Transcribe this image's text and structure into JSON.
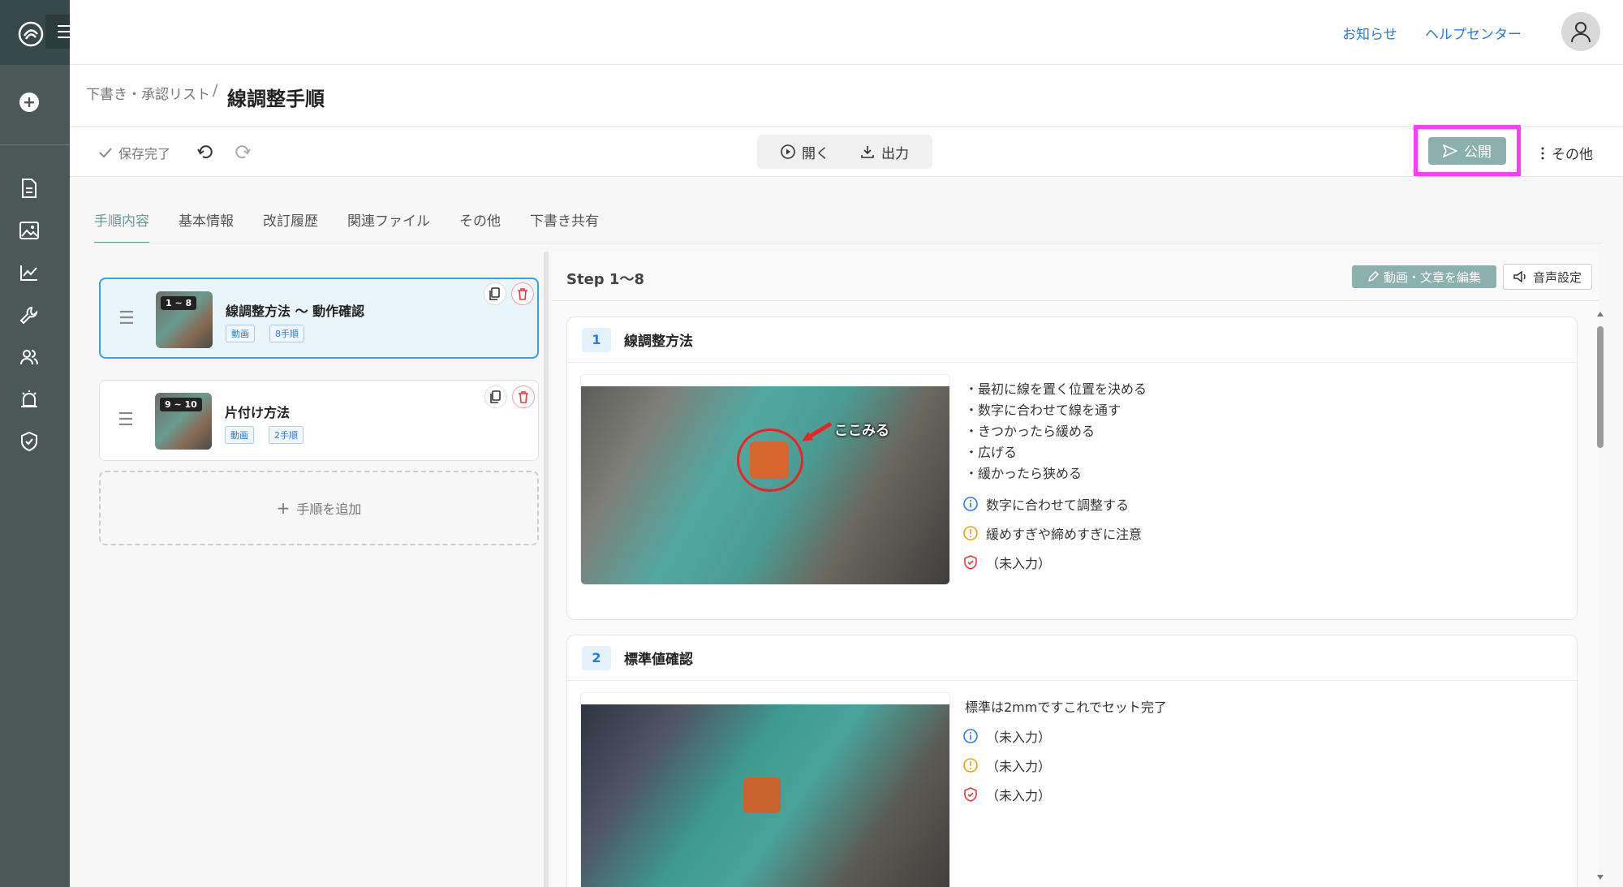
{
  "header": {
    "notices_label": "お知らせ",
    "help_label": "ヘルプセンター"
  },
  "breadcrumb": {
    "parent": "下書き・承認リスト",
    "separator": "/",
    "title": "線調整手順"
  },
  "toolbar": {
    "saved_label": "保存完了",
    "open_label": "開く",
    "export_label": "出力",
    "publish_label": "公開",
    "more_label": "その他"
  },
  "tabs": [
    {
      "label": "手順内容",
      "active": true
    },
    {
      "label": "基本情報"
    },
    {
      "label": "改訂履歴"
    },
    {
      "label": "関連ファイル"
    },
    {
      "label": "その他"
    },
    {
      "label": "下書き共有"
    }
  ],
  "step_cards": [
    {
      "badge": "1 ~ 8",
      "title": "線調整方法 ～ 動作確認",
      "tag1": "動画",
      "tag2": "8手順"
    },
    {
      "badge": "9 ~ 10",
      "title": "片付け方法",
      "tag1": "動画",
      "tag2": "2手順"
    }
  ],
  "add_step_label": "手順を追加",
  "right": {
    "step_range": "Step 1〜8",
    "edit_label": "動画・文章を編集",
    "audio_label": "音声設定"
  },
  "steps": [
    {
      "number": "1",
      "name": "線調整方法",
      "video_caption": "ここみる",
      "lines": [
        "・最初に線を置く位置を決める",
        "・数字に合わせて線を通す",
        "・きつかったら緩める",
        "・広げる",
        "・緩かったら狭める"
      ],
      "info": "数字に合わせて調整する",
      "caution": "緩めすぎや締めすぎに注意",
      "safety": "（未入力）"
    },
    {
      "number": "2",
      "name": "標準値確認",
      "lines": [
        "標準は2mmですこれでセット完了"
      ],
      "info": "（未入力）",
      "caution": "（未入力）",
      "safety": "（未入力）"
    }
  ],
  "colors": {
    "accent": "#6a9a96",
    "link": "#2d7bd6",
    "highlight": "#ff3df5",
    "sidebar": "#4a5958"
  }
}
